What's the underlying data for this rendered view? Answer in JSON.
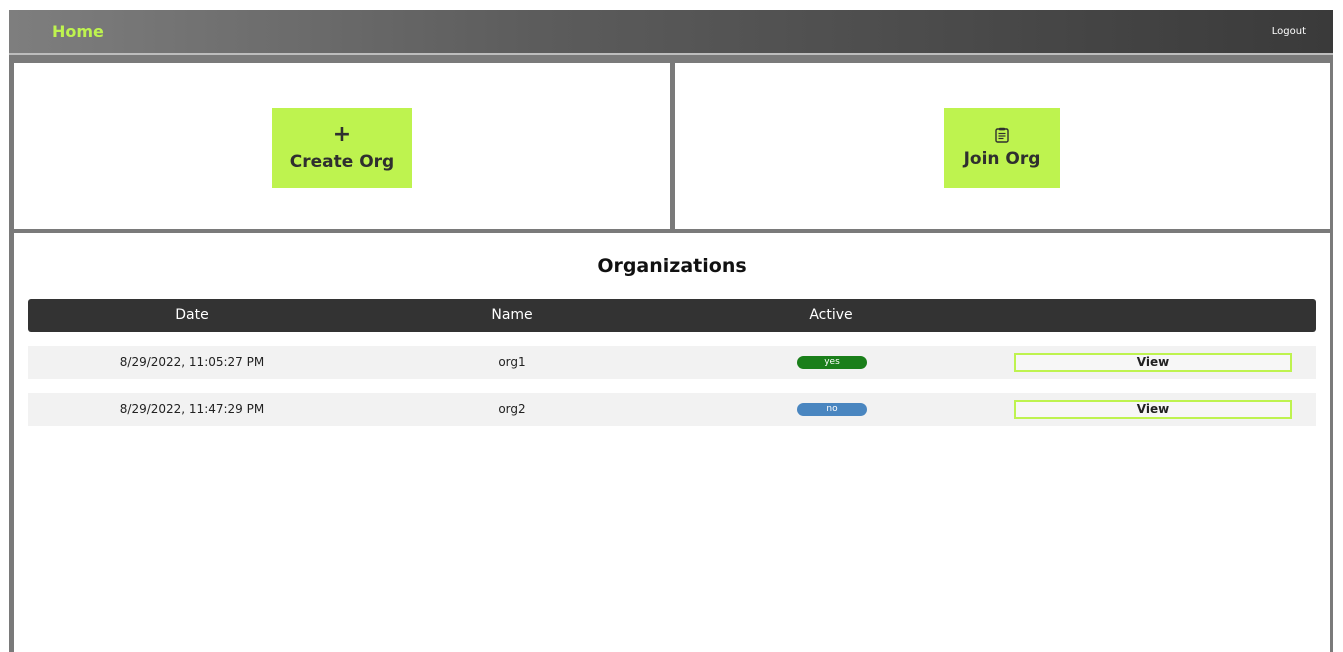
{
  "header": {
    "brand": "Home",
    "logout_label": "Logout"
  },
  "actions": {
    "create": {
      "glyph": "+",
      "label": "Create Org"
    },
    "join": {
      "label": "Join Org"
    }
  },
  "organizations": {
    "title": "Organizations",
    "columns": [
      "Date",
      "Name",
      "Active",
      ""
    ],
    "rows": [
      {
        "date": "8/29/2022, 11:05:27 PM",
        "name": "org1",
        "active": "yes",
        "view_label": "View"
      },
      {
        "date": "8/29/2022, 11:47:29 PM",
        "name": "org2",
        "active": "no",
        "view_label": "View"
      }
    ]
  },
  "colors": {
    "accent": "#bef34f",
    "active_yes": "#1a7f1a",
    "active_no": "#4a86c0",
    "header_dark": "#333333"
  },
  "icons": {
    "create": "plus-icon",
    "join": "clipboard-list-icon"
  }
}
